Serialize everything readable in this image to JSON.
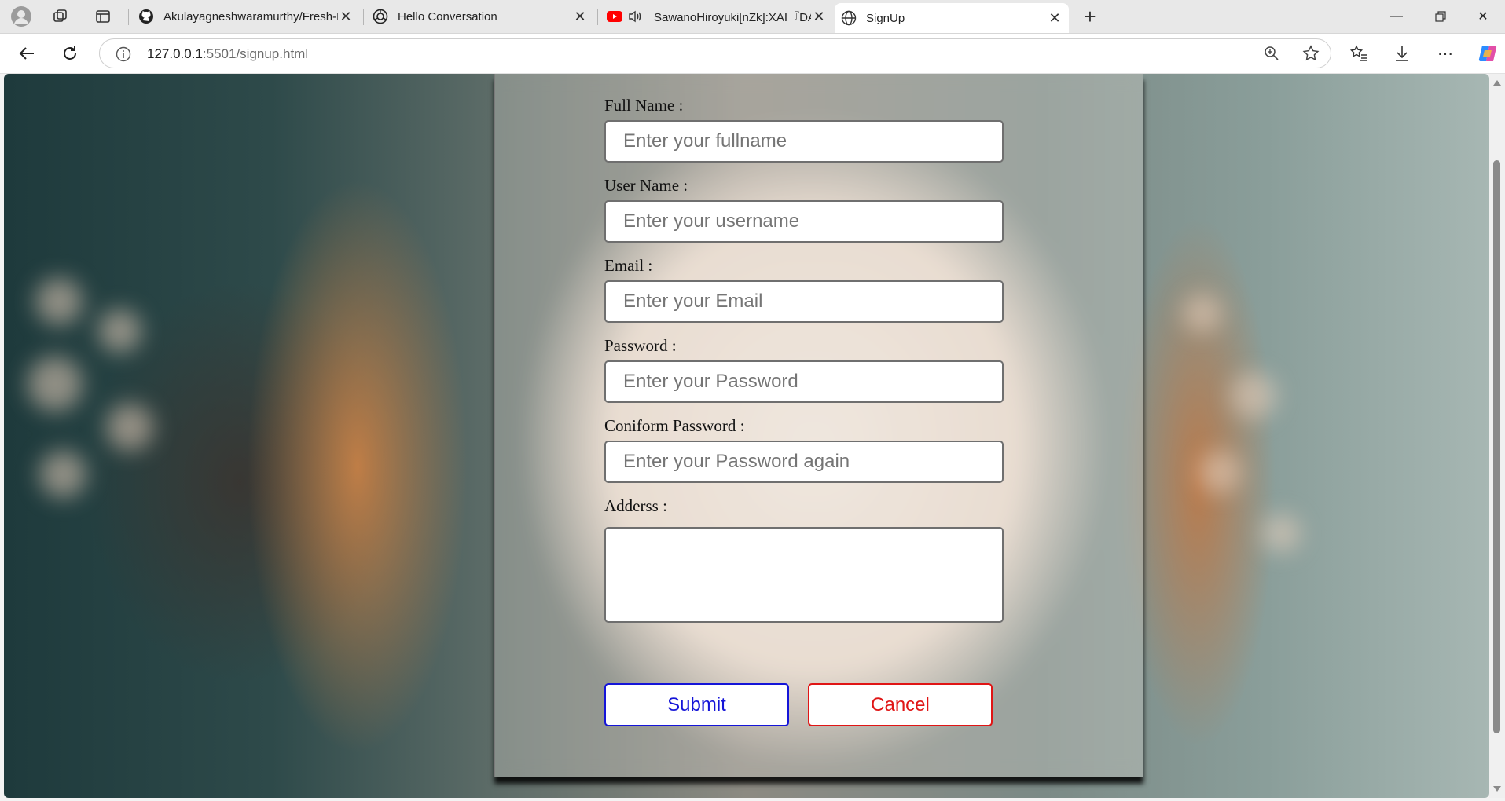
{
  "browser": {
    "tabs": [
      {
        "title": "Akulayagneshwaramurthy/Fresh-F",
        "icon": "github-icon"
      },
      {
        "title": "Hello Conversation",
        "icon": "openai-icon"
      },
      {
        "title": "SawanoHiroyuki[nZk]:XAI『DA",
        "icon": "youtube-icon"
      },
      {
        "title": "SignUp",
        "icon": "globe-icon"
      }
    ],
    "url_host": "127.0.0.1",
    "url_rest": ":5501/signup.html"
  },
  "form": {
    "fullname": {
      "label": "Full Name :",
      "placeholder": "Enter your fullname"
    },
    "username": {
      "label": "User Name :",
      "placeholder": "Enter your username"
    },
    "email": {
      "label": "Email :",
      "placeholder": "Enter your Email"
    },
    "password": {
      "label": "Password :",
      "placeholder": "Enter your Password"
    },
    "confirm": {
      "label": "Coniform Password :",
      "placeholder": "Enter your Password again"
    },
    "address": {
      "label": "Adderss :"
    },
    "submit_label": "Submit",
    "cancel_label": "Cancel"
  },
  "colors": {
    "submit": "#1515d8",
    "cancel": "#e01515"
  }
}
